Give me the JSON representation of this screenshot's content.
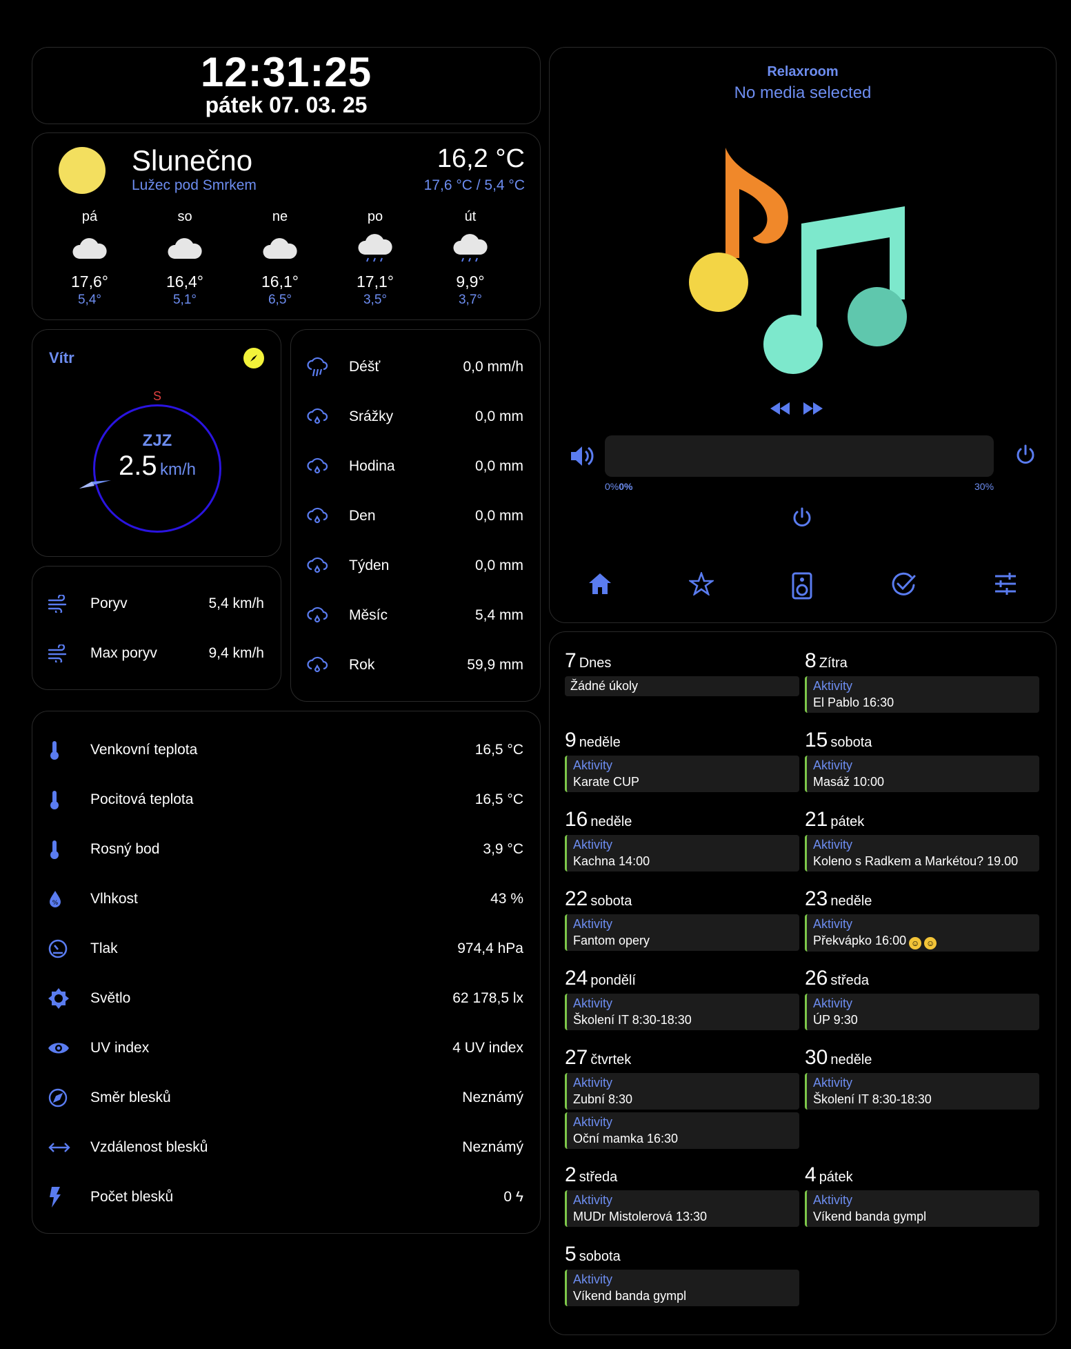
{
  "clock": {
    "time": "12:31:25",
    "date": "pátek 07. 03. 25"
  },
  "weather": {
    "condition": "Slunečno",
    "location": "Lužec pod Smrkem",
    "temperature": "16,2 °C",
    "range": "17,6 °C / 5,4 °C",
    "forecast": [
      {
        "day": "pá",
        "high": "17,6°",
        "low": "5,4°",
        "icon": "cloud-icon"
      },
      {
        "day": "so",
        "high": "16,4°",
        "low": "5,1°",
        "icon": "cloud-icon"
      },
      {
        "day": "ne",
        "high": "16,1°",
        "low": "6,5°",
        "icon": "cloud-icon"
      },
      {
        "day": "po",
        "high": "17,1°",
        "low": "3,5°",
        "icon": "cloud-rain-icon"
      },
      {
        "day": "út",
        "high": "9,9°",
        "low": "3,7°",
        "icon": "cloud-rain-icon"
      }
    ]
  },
  "wind": {
    "title": "Vítr",
    "cardinal": "S",
    "direction": "ZJZ",
    "speed": "2.5",
    "unit": "km/h"
  },
  "gust": [
    {
      "label": "Poryv",
      "value": "5,4 km/h",
      "icon": "wind-icon"
    },
    {
      "label": "Max poryv",
      "value": "9,4 km/h",
      "icon": "wind-icon"
    }
  ],
  "rain": [
    {
      "label": "Déšť",
      "value": "0,0 mm/h",
      "icon": "rain-rate-icon"
    },
    {
      "label": "Srážky",
      "value": "0,0 mm",
      "icon": "rain-drop-icon"
    },
    {
      "label": "Hodina",
      "value": "0,0 mm",
      "icon": "rain-drop-icon"
    },
    {
      "label": "Den",
      "value": "0,0 mm",
      "icon": "rain-drop-icon"
    },
    {
      "label": "Týden",
      "value": "0,0 mm",
      "icon": "rain-drop-icon"
    },
    {
      "label": "Měsíc",
      "value": "5,4 mm",
      "icon": "rain-drop-icon"
    },
    {
      "label": "Rok",
      "value": "59,9 mm",
      "icon": "rain-drop-icon"
    }
  ],
  "sensors": [
    {
      "label": "Venkovní teplota",
      "value": "16,5 °C",
      "icon": "thermometer-icon"
    },
    {
      "label": "Pocitová teplota",
      "value": "16,5 °C",
      "icon": "thermometer-icon"
    },
    {
      "label": "Rosný bod",
      "value": "3,9 °C",
      "icon": "thermometer-icon"
    },
    {
      "label": "Vlhkost",
      "value": "43 %",
      "icon": "humidity-icon"
    },
    {
      "label": "Tlak",
      "value": "974,4 hPa",
      "icon": "gauge-icon"
    },
    {
      "label": "Světlo",
      "value": "62 178,5 lx",
      "icon": "sun-icon"
    },
    {
      "label": "UV index",
      "value": "4 UV index",
      "icon": "eye-icon"
    },
    {
      "label": "Směr blesků",
      "value": "Neznámý",
      "icon": "compass-icon"
    },
    {
      "label": "Vzdálenost blesků",
      "value": "Neznámý",
      "icon": "arrows-horizontal-icon"
    },
    {
      "label": "Počet blesků",
      "value": "0 ϟ",
      "icon": "lightning-icon"
    }
  ],
  "media": {
    "room": "Relaxroom",
    "status": "No media selected",
    "volume_left": "0%",
    "volume_bold": "0%",
    "volume_right": "30%",
    "volume_level": 0.3,
    "nav": [
      "home-icon",
      "star-icon",
      "speaker-icon",
      "check-circle-icon",
      "tune-icon"
    ]
  },
  "calendar": [
    {
      "num": "7",
      "name": "Dnes",
      "events": [
        {
          "category": "",
          "text": "Žádné úkoly"
        }
      ]
    },
    {
      "num": "8",
      "name": "Zítra",
      "events": [
        {
          "category": "Aktivity",
          "text": "El Pablo 16:30"
        }
      ]
    },
    {
      "num": "9",
      "name": "neděle",
      "events": [
        {
          "category": "Aktivity",
          "text": "Karate CUP"
        }
      ]
    },
    {
      "num": "15",
      "name": "sobota",
      "events": [
        {
          "category": "Aktivity",
          "text": "Masáž 10:00"
        }
      ]
    },
    {
      "num": "16",
      "name": "neděle",
      "events": [
        {
          "category": "Aktivity",
          "text": "Kachna 14:00"
        }
      ]
    },
    {
      "num": "21",
      "name": "pátek",
      "events": [
        {
          "category": "Aktivity",
          "text": "Koleno s Radkem a Markétou? 19.00"
        }
      ]
    },
    {
      "num": "22",
      "name": "sobota",
      "events": [
        {
          "category": "Aktivity",
          "text": "Fantom opery"
        }
      ]
    },
    {
      "num": "23",
      "name": "neděle",
      "events": [
        {
          "category": "Aktivity",
          "text": "Překvápko 16:00"
        }
      ]
    },
    {
      "num": "24",
      "name": "pondělí",
      "events": [
        {
          "category": "Aktivity",
          "text": "Školení IT 8:30-18:30"
        }
      ]
    },
    {
      "num": "26",
      "name": "středa",
      "events": [
        {
          "category": "Aktivity",
          "text": "ÚP 9:30"
        }
      ]
    },
    {
      "num": "27",
      "name": "čtvrtek",
      "events": [
        {
          "category": "Aktivity",
          "text": "Zubní 8:30"
        },
        {
          "category": "Aktivity",
          "text": "Oční mamka 16:30"
        }
      ]
    },
    {
      "num": "30",
      "name": "neděle",
      "events": [
        {
          "category": "Aktivity",
          "text": "Školení IT 8:30-18:30"
        }
      ]
    },
    {
      "num": "2",
      "name": "středa",
      "events": [
        {
          "category": "Aktivity",
          "text": "MUDr Mistolerová 13:30"
        }
      ]
    },
    {
      "num": "4",
      "name": "pátek",
      "events": [
        {
          "category": "Aktivity",
          "text": "Víkend banda gympl"
        }
      ]
    },
    {
      "num": "5",
      "name": "sobota",
      "events": [
        {
          "category": "Aktivity",
          "text": "Víkend banda gympl"
        }
      ]
    }
  ]
}
